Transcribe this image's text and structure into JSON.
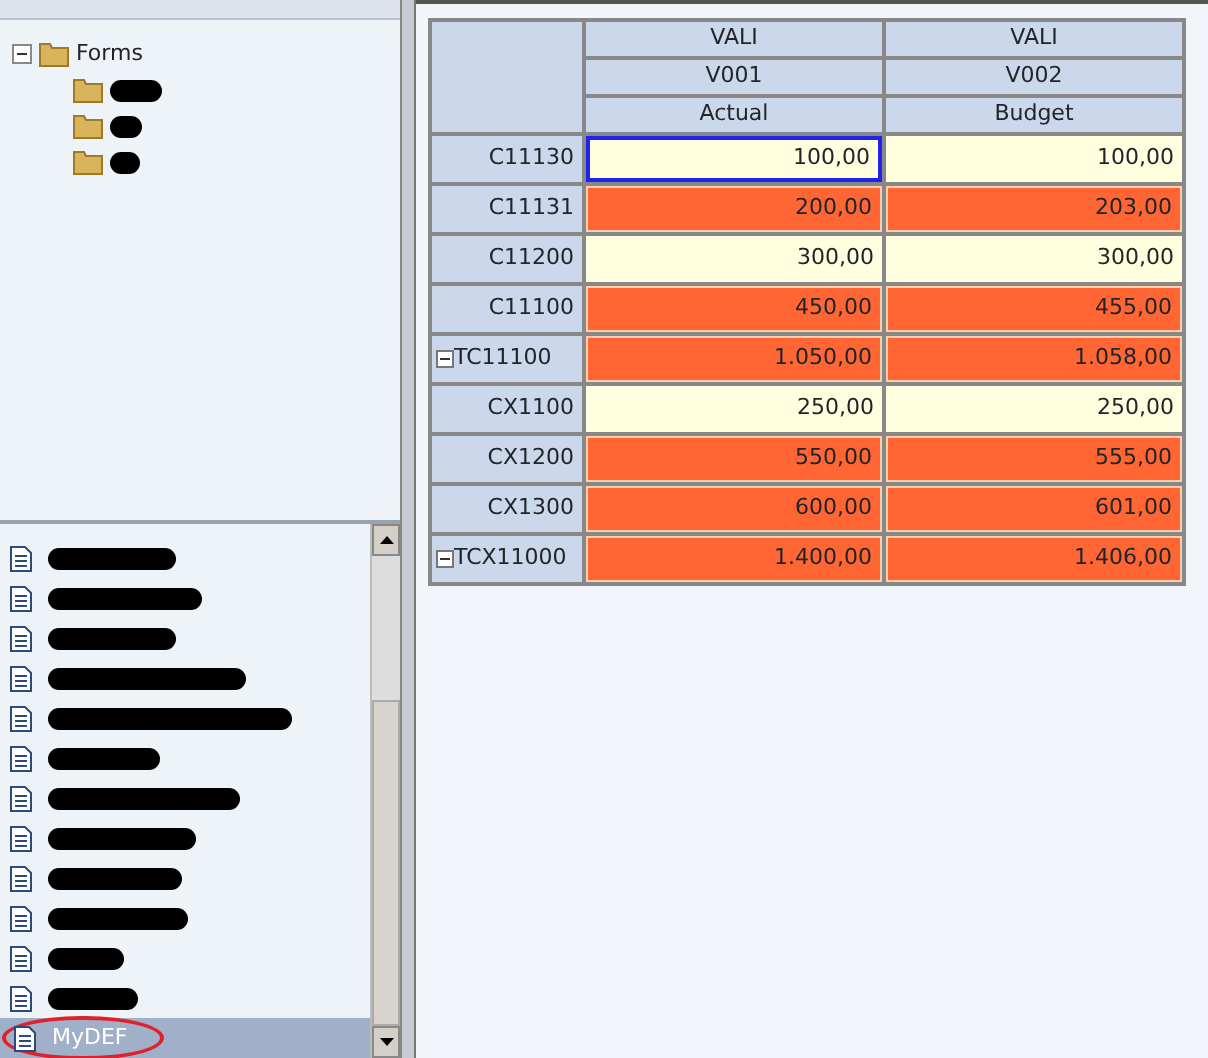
{
  "tree": {
    "root": {
      "label": "Forms",
      "expanded": true
    },
    "children": [
      {
        "kind": "redacted"
      },
      {
        "kind": "redacted"
      },
      {
        "kind": "redacted"
      }
    ]
  },
  "list": {
    "items": [
      {
        "kind": "redacted",
        "selected": false
      },
      {
        "kind": "redacted",
        "selected": false
      },
      {
        "kind": "redacted",
        "selected": false
      },
      {
        "kind": "redacted",
        "selected": false
      },
      {
        "kind": "redacted",
        "selected": false
      },
      {
        "kind": "redacted",
        "selected": false
      },
      {
        "kind": "redacted",
        "selected": false
      },
      {
        "kind": "redacted",
        "selected": false
      },
      {
        "kind": "redacted",
        "selected": false
      },
      {
        "kind": "redacted",
        "selected": false
      },
      {
        "kind": "redacted",
        "selected": false
      },
      {
        "kind": "redacted",
        "selected": false
      },
      {
        "kind": "named",
        "label": "MyDEF",
        "selected": true,
        "circled": true
      }
    ]
  },
  "grid": {
    "header_rows": [
      [
        "VALI",
        "VALI"
      ],
      [
        "V001",
        "V002"
      ],
      [
        "Actual",
        "Budget"
      ]
    ],
    "rows": [
      {
        "label": "C11130",
        "expanded": null,
        "cells": [
          {
            "value": "100,00",
            "flagged": false,
            "focused": true
          },
          {
            "value": "100,00",
            "flagged": false,
            "focused": false
          }
        ]
      },
      {
        "label": "C11131",
        "expanded": null,
        "cells": [
          {
            "value": "200,00",
            "flagged": true,
            "focused": false
          },
          {
            "value": "203,00",
            "flagged": true,
            "focused": false
          }
        ]
      },
      {
        "label": "C11200",
        "expanded": null,
        "cells": [
          {
            "value": "300,00",
            "flagged": false,
            "focused": false
          },
          {
            "value": "300,00",
            "flagged": false,
            "focused": false
          }
        ]
      },
      {
        "label": "C11100",
        "expanded": null,
        "cells": [
          {
            "value": "450,00",
            "flagged": true,
            "focused": false
          },
          {
            "value": "455,00",
            "flagged": true,
            "focused": false
          }
        ]
      },
      {
        "label": "TC11100",
        "expanded": true,
        "cells": [
          {
            "value": "1.050,00",
            "flagged": true,
            "focused": false
          },
          {
            "value": "1.058,00",
            "flagged": true,
            "focused": false
          }
        ]
      },
      {
        "label": "CX1100",
        "expanded": null,
        "cells": [
          {
            "value": "250,00",
            "flagged": false,
            "focused": false
          },
          {
            "value": "250,00",
            "flagged": false,
            "focused": false
          }
        ]
      },
      {
        "label": "CX1200",
        "expanded": null,
        "cells": [
          {
            "value": "550,00",
            "flagged": true,
            "focused": false
          },
          {
            "value": "555,00",
            "flagged": true,
            "focused": false
          }
        ]
      },
      {
        "label": "CX1300",
        "expanded": null,
        "cells": [
          {
            "value": "600,00",
            "flagged": true,
            "focused": false
          },
          {
            "value": "601,00",
            "flagged": true,
            "focused": false
          }
        ]
      },
      {
        "label": "TCX11000",
        "expanded": true,
        "cells": [
          {
            "value": "1.400,00",
            "flagged": true,
            "focused": false
          },
          {
            "value": "1.406,00",
            "flagged": true,
            "focused": false
          }
        ]
      }
    ]
  }
}
